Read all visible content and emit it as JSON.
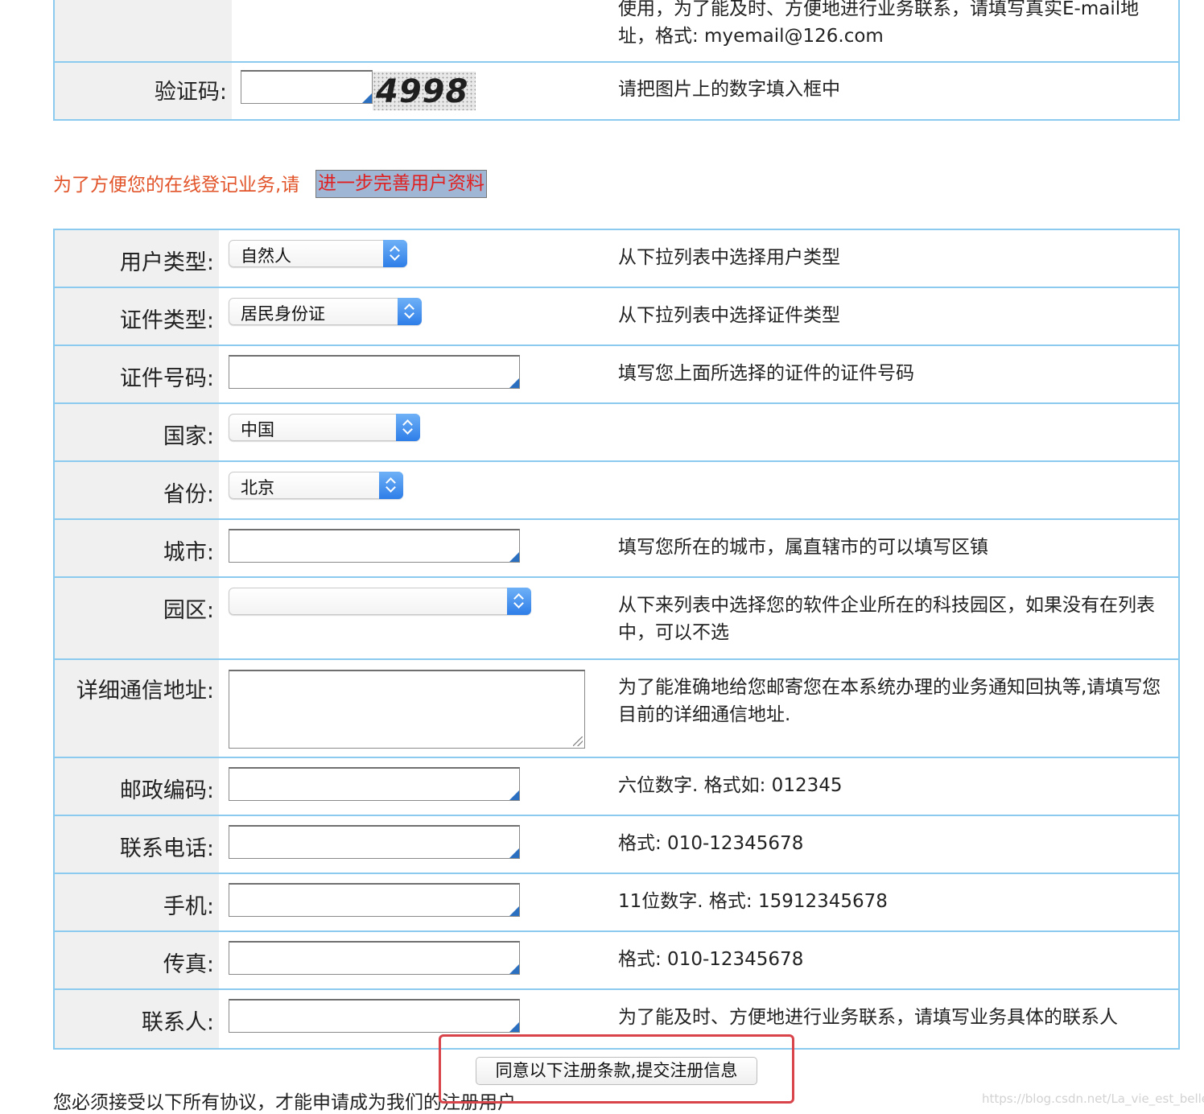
{
  "top_table": {
    "email_hint_line1": "使用，为了能及时、方便地进行业务联系，请填写真实E-mail地",
    "email_hint_line2": "址，格式: myemail@126.com",
    "captcha_label": "验证码:",
    "captcha_value": "",
    "captcha_image_text": "4998",
    "captcha_hint": "请把图片上的数字填入框中"
  },
  "notice": {
    "text": "为了方便您的在线登记业务,请",
    "link": "进一步完善用户资料"
  },
  "form": {
    "user_type": {
      "label": "用户类型:",
      "value": "自然人",
      "hint": "从下拉列表中选择用户类型"
    },
    "id_type": {
      "label": "证件类型:",
      "value": "居民身份证",
      "hint": "从下拉列表中选择证件类型"
    },
    "id_number": {
      "label": "证件号码:",
      "value": "",
      "hint": "填写您上面所选择的证件的证件号码"
    },
    "country": {
      "label": "国家:",
      "value": "中国",
      "hint": ""
    },
    "province": {
      "label": "省份:",
      "value": "北京",
      "hint": ""
    },
    "city": {
      "label": "城市:",
      "value": "",
      "hint": "填写您所在的城市，属直辖市的可以填写区镇"
    },
    "park": {
      "label": "园区:",
      "value": "",
      "hint": "从下来列表中选择您的软件企业所在的科技园区，如果没有在列表中，可以不选"
    },
    "address": {
      "label": "详细通信地址:",
      "value": "",
      "hint": "为了能准确地给您邮寄您在本系统办理的业务通知回执等,请填写您目前的详细通信地址."
    },
    "postcode": {
      "label": "邮政编码:",
      "value": "",
      "hint": "六位数字. 格式如: 012345"
    },
    "phone": {
      "label": "联系电话:",
      "value": "",
      "hint": "格式: 010-12345678"
    },
    "mobile": {
      "label": "手机:",
      "value": "",
      "hint": "11位数字. 格式: 15912345678"
    },
    "fax": {
      "label": "传真:",
      "value": "",
      "hint": "格式: 010-12345678"
    },
    "contact": {
      "label": "联系人:",
      "value": "",
      "hint": "为了能及时、方便地进行业务联系，请填写业务具体的联系人"
    }
  },
  "submit_label": "同意以下注册条款,提交注册信息",
  "agreement_text": "您必须接受以下所有协议，才能申请成为我们的注册用户",
  "watermark": "https://blog.csdn.net/La_vie_est_belle",
  "colors": {
    "border": "#8ccbf0",
    "label_bg": "#f0f0f0",
    "notice": "#e2542a",
    "highlight": "#d9444b"
  }
}
